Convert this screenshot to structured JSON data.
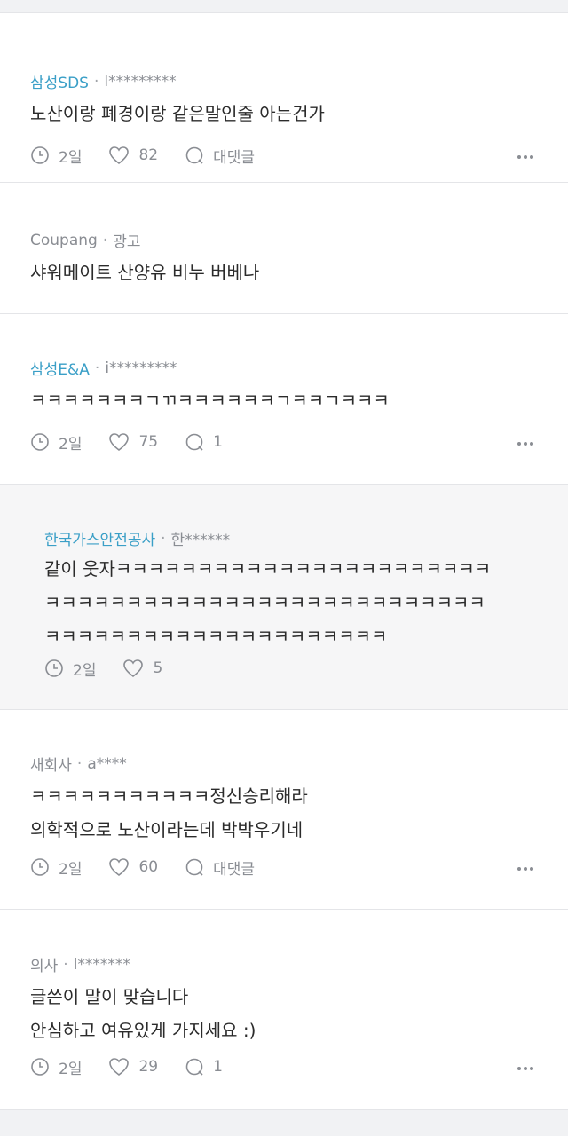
{
  "comments": [
    {
      "company": "삼성SDS",
      "user": "l*********",
      "text": "노산이랑 폐경이랑 같은말인줄 아는건가",
      "time": "2일",
      "likes": "82",
      "reply": "대댓글"
    },
    {
      "company": "Coupang",
      "user": "광고",
      "text": "샤워메이트 산양유 비누 버베나"
    },
    {
      "company": "삼성E&A",
      "user": "i*********",
      "text": "ㅋㅋㅋㅋㅋㅋㅋㄱㄲㅋㅋㅋㅋㅋㅋㄱㅋㅋㄱㅋㅋㅋ",
      "time": "2일",
      "likes": "75",
      "reply": "1"
    },
    {
      "company": "한국가스안전공사",
      "user": "한******",
      "text": "같이 웃자ㅋㅋㅋㅋㅋㅋㅋㅋㅋㅋㅋㅋㅋㅋㅋㅋㅋㅋㅋㅋㅋㅋㅋ\nㅋㅋㅋㅋㅋㅋㅋㅋㅋㅋㅋㅋㅋㅋㅋㅋㅋㅋㅋㅋㅋㅋㅋㅋㅋㅋㅋ\nㅋㅋㅋㅋㅋㅋㅋㅋㅋㅋㅋㅋㅋㅋㅋㅋㅋㅋㅋㅋㅋ",
      "time": "2일",
      "likes": "5"
    },
    {
      "company": "새회사",
      "user": "a****",
      "text": "ㅋㅋㅋㅋㅋㅋㅋㅋㅋㅋㅋ정신승리해라\n의학적으로 노산이라는데 박박우기네",
      "time": "2일",
      "likes": "60",
      "reply": "대댓글"
    },
    {
      "company": "의사",
      "user": "l*******",
      "text": "글쓴이 말이 맞습니다\n안심하고 여유있게 가지세요 :)",
      "time": "2일",
      "likes": "29",
      "reply": "1"
    }
  ],
  "icons": {
    "time": "clock-icon",
    "like": "heart-icon",
    "reply": "speech-bubble-icon",
    "more": "more-dots-icon"
  }
}
